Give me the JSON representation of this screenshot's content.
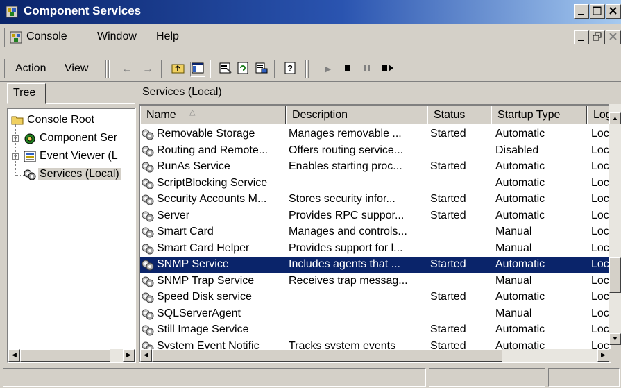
{
  "window": {
    "title": "Component Services"
  },
  "menubar": {
    "items": [
      {
        "label": "Console"
      },
      {
        "label": "Window"
      },
      {
        "label": "Help"
      }
    ]
  },
  "toolbar": {
    "action_label": "Action",
    "view_label": "View"
  },
  "tree": {
    "header": "Tree",
    "nodes": [
      {
        "label": "Console Root"
      },
      {
        "label": "Component Ser"
      },
      {
        "label": "Event Viewer (L"
      },
      {
        "label": "Services (Local)"
      }
    ]
  },
  "list": {
    "title": "Services (Local)",
    "columns": [
      "Name",
      "Description",
      "Status",
      "Startup Type",
      "Log"
    ],
    "rows": [
      {
        "name": "Removable Storage",
        "description": "Manages removable ...",
        "status": "Started",
        "startup": "Automatic",
        "logon": "Loc"
      },
      {
        "name": "Routing and Remote...",
        "description": "Offers routing service...",
        "status": "",
        "startup": "Disabled",
        "logon": "Loc"
      },
      {
        "name": "RunAs Service",
        "description": "Enables starting proc...",
        "status": "Started",
        "startup": "Automatic",
        "logon": "Loc"
      },
      {
        "name": "ScriptBlocking Service",
        "description": "",
        "status": "",
        "startup": "Automatic",
        "logon": "Loc"
      },
      {
        "name": "Security Accounts M...",
        "description": "Stores security infor...",
        "status": "Started",
        "startup": "Automatic",
        "logon": "Loc"
      },
      {
        "name": "Server",
        "description": "Provides RPC suppor...",
        "status": "Started",
        "startup": "Automatic",
        "logon": "Loc"
      },
      {
        "name": "Smart Card",
        "description": "Manages and controls...",
        "status": "",
        "startup": "Manual",
        "logon": "Loc"
      },
      {
        "name": "Smart Card Helper",
        "description": "Provides support for l...",
        "status": "",
        "startup": "Manual",
        "logon": "Loc"
      },
      {
        "name": "SNMP Service",
        "description": "Includes agents that ...",
        "status": "Started",
        "startup": "Automatic",
        "logon": "Loc"
      },
      {
        "name": "SNMP Trap Service",
        "description": "Receives trap messag...",
        "status": "",
        "startup": "Manual",
        "logon": "Loc"
      },
      {
        "name": "Speed Disk service",
        "description": "",
        "status": "Started",
        "startup": "Automatic",
        "logon": "Loc"
      },
      {
        "name": "SQLServerAgent",
        "description": "",
        "status": "",
        "startup": "Manual",
        "logon": "Loc"
      },
      {
        "name": "Still Image Service",
        "description": "",
        "status": "Started",
        "startup": "Automatic",
        "logon": "Loc"
      },
      {
        "name": "System Event Notific",
        "description": "Tracks system events",
        "status": "Started",
        "startup": "Automatic",
        "logon": "Loc"
      }
    ],
    "selected_row_index": 8
  },
  "colors": {
    "titlebar_start": "#0a246a",
    "titlebar_end": "#a6caf0",
    "selection": "#0a246a",
    "face": "#d4d0c8"
  }
}
